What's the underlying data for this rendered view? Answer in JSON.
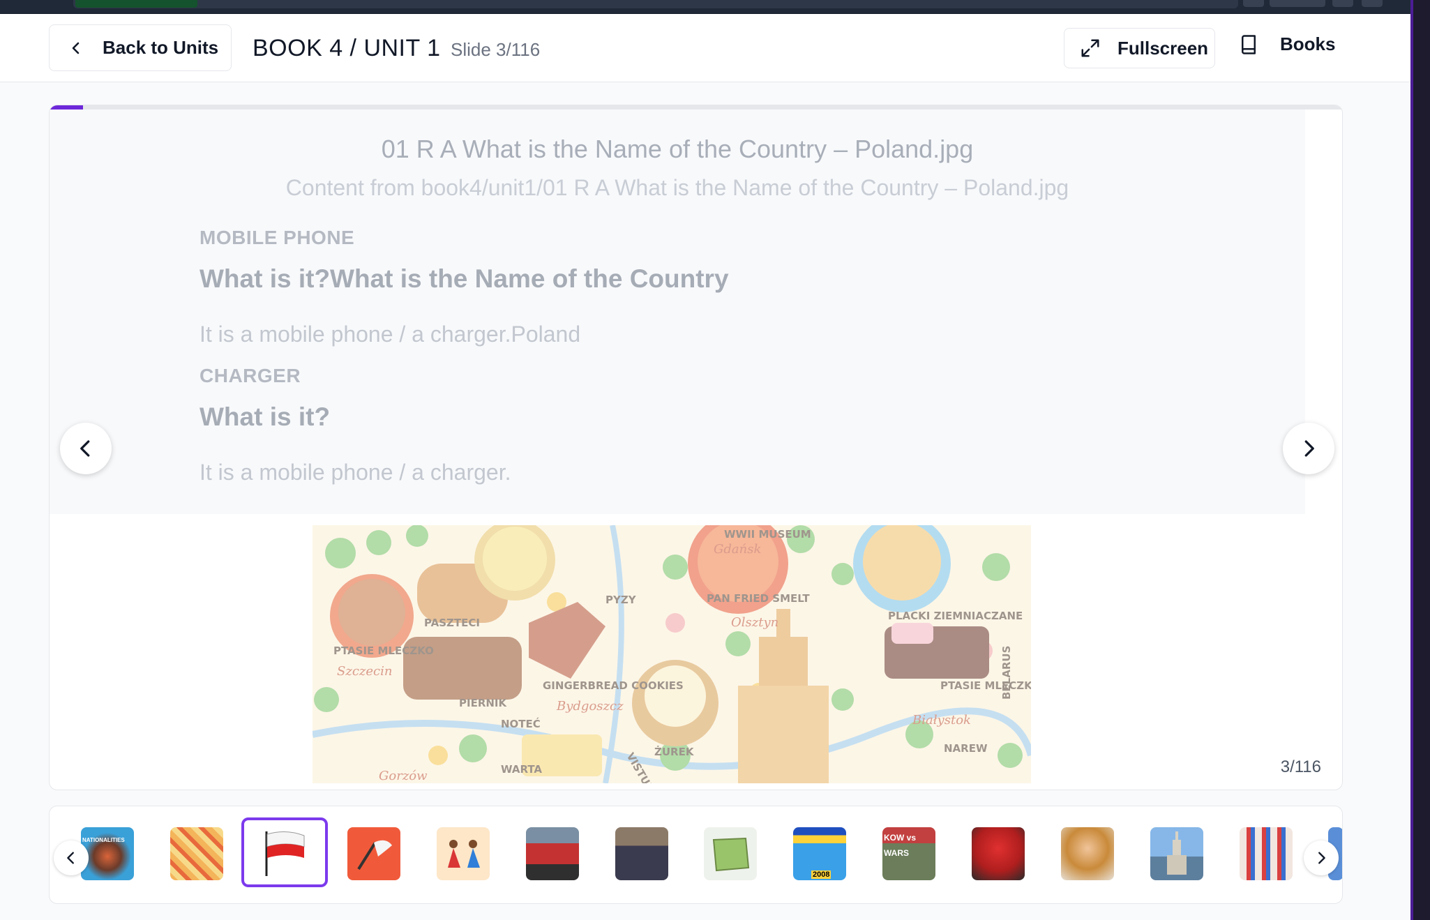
{
  "header": {
    "back_label": "Back to Units",
    "title": "BOOK 4 / UNIT 1",
    "slide_label": "Slide 3/116",
    "fullscreen_label": "Fullscreen",
    "books_label": "Books"
  },
  "slide": {
    "doc_title": "01 R A What is the Name of the Country – Poland.jpg",
    "doc_subtitle": "Content from book4/unit1/01 R A What is the Name of the Country – Poland.jpg",
    "blocks": [
      {
        "label": "MOBILE PHONE",
        "question": "What is it?What is the Name of the Country",
        "answer": "It is a mobile phone / a charger.Poland"
      },
      {
        "label": "CHARGER",
        "question": "What is it?",
        "answer": "It is a mobile phone / a charger."
      }
    ],
    "counter": "3/116",
    "progress_fraction": 0.026,
    "image_labels": [
      "WWII MUSEUM",
      "Gdańsk",
      "PASZTECI",
      "PYZY",
      "PAN FRIED SMELT",
      "Olsztyn",
      "PLACKI ZIEMNIACZANE",
      "PTASIE MLECZKO",
      "Szczecin",
      "PIERNIK",
      "GINGERBREAD COOKIES",
      "Bydgoszcz",
      "NOTEĆ",
      "ŻUREK",
      "PTASIE MLECZKO",
      "Białystok",
      "BELARUS",
      "NAREW",
      "WARTA",
      "Gorzów",
      "VISTULA"
    ]
  },
  "thumbnails": {
    "selected_index": 2,
    "thumb_labels": [
      "NATIONALITIES",
      "",
      "",
      "",
      "",
      "",
      "",
      "",
      "2008",
      "KOW vs WARS",
      "",
      "",
      "",
      ""
    ]
  },
  "colors": {
    "accent": "#7c3aed",
    "progress": "#6d28d9"
  }
}
